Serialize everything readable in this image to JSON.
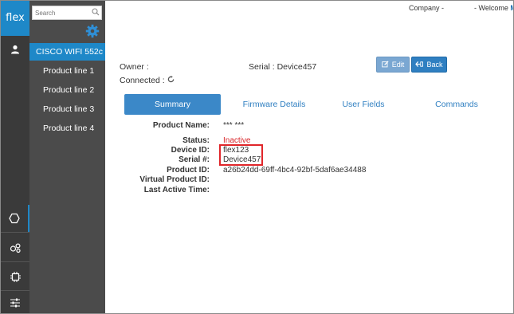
{
  "logo": "flex",
  "search": {
    "placeholder": "Search"
  },
  "sidebar": {
    "selected": "CISCO WIFI 552c",
    "items": [
      "Product line 1",
      "Product line 2",
      "Product line 3",
      "Product line 4"
    ]
  },
  "header": {
    "company_label": "Company -",
    "welcome_label": "- Welcome",
    "welcome_name": "M"
  },
  "device": {
    "owner_label": "Owner :",
    "serial_label": "Serial : Device457",
    "connected_label": "Connected :"
  },
  "buttons": {
    "edit": "Edit",
    "back": "Back"
  },
  "tabs": [
    "Summary",
    "Firmware Details",
    "User Fields",
    "Commands"
  ],
  "summary": {
    "product_name_label": "Product Name:",
    "product_name_value": "*** ***",
    "status_label": "Status:",
    "status_value": "Inactive",
    "device_id_label": "Device ID:",
    "device_id_value": "flex123",
    "serial_label": "Serial #:",
    "serial_value": "Device457",
    "product_id_label": "Product ID:",
    "product_id_value": "a26b24dd-69ff-4bc4-92bf-5daf6ae34488",
    "virtual_product_id_label": "Virtual Product ID:",
    "last_active_label": "Last Active Time:"
  },
  "colors": {
    "accent": "#1e88c8",
    "rail": "#3a3a3a",
    "sidebar": "#4b4b4b",
    "status_inactive": "#d9262a",
    "highlight": "#e0262a"
  }
}
